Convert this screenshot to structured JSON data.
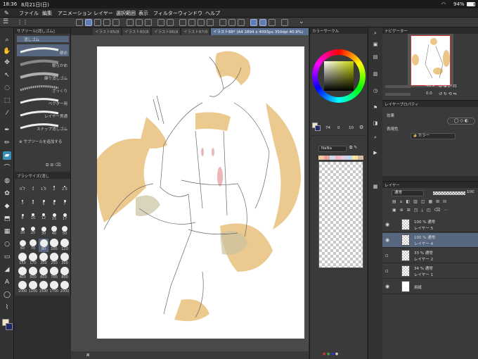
{
  "status": {
    "time": "18:36",
    "date": "8月21日(日)",
    "battery": "94%"
  },
  "menu": [
    "ファイル",
    "編集",
    "アニメーション",
    "レイヤー",
    "選択範囲",
    "表示",
    "フィルター",
    "ウィンドウ",
    "ヘルプ"
  ],
  "tabs": [
    "イラスト85(8",
    "イラスト80(8",
    "イラスト86(8",
    "イラスト87(8",
    "イラスト88* (A4 2894 x 4093px 350dpi 40.9%)"
  ],
  "subtool": {
    "header": "サブツール[消しゴム]",
    "group_tab": "消しゴム",
    "brushes": [
      "硬め",
      "軟らかめ",
      "練り消しゴム",
      "ざっくり",
      "ベクター用",
      "レイヤー貫通",
      "スナップ消しゴム"
    ],
    "add_label": "サブツールを追加する"
  },
  "brush_size": {
    "header": "ブラシサイズ(消し",
    "sizes": [
      "0.7",
      "1",
      "1.5",
      "2",
      "2.5",
      "3",
      "4",
      "5",
      "6",
      "7",
      "8",
      "10",
      "12",
      "15",
      "17",
      "20",
      "25",
      "30",
      "40",
      "50",
      "60",
      "70",
      "80",
      "100",
      "120",
      "150",
      "170",
      "200",
      "250",
      "300",
      "400",
      "500",
      "600",
      "700",
      "800",
      "1000",
      "1200",
      "1500",
      "1700",
      "2000"
    ],
    "selected": "80"
  },
  "color": {
    "header": "カラーサークル",
    "h": "74",
    "s": "0",
    "v": "10",
    "main": "#f0e4c8",
    "sub": "#1a2a6a"
  },
  "palette": {
    "name": "NaNa",
    "swatches": [
      "#f3c2a7",
      "#e6a58e",
      "#cfd6f0",
      "#f2b6be",
      "#e5c9e6",
      "#bfd7f5",
      "#f7e2a5",
      "#d9b7a1"
    ]
  },
  "navigator": {
    "header": "ナビゲーター",
    "zoom": "40.9",
    "angle": "0.0"
  },
  "layer_property": {
    "header": "レイヤープロパティ",
    "effect_label": "効果",
    "display_color_label": "表現色",
    "display_color_value": "カラー"
  },
  "layers": {
    "header": "レイヤー",
    "blend": "通常",
    "opacity": "100",
    "items": [
      {
        "pct": "100 % 通常",
        "name": "レイヤー 5",
        "visible": true,
        "selected": false
      },
      {
        "pct": "100 % 通常",
        "name": "レイヤー 4",
        "visible": true,
        "selected": true
      },
      {
        "pct": "33 % 通常",
        "name": "レイヤー 2",
        "visible": false,
        "selected": false
      },
      {
        "pct": "34 % 通常",
        "name": "レイヤー 1",
        "visible": false,
        "selected": false
      },
      {
        "pct": "",
        "name": "用紙",
        "visible": true,
        "selected": false
      }
    ]
  }
}
